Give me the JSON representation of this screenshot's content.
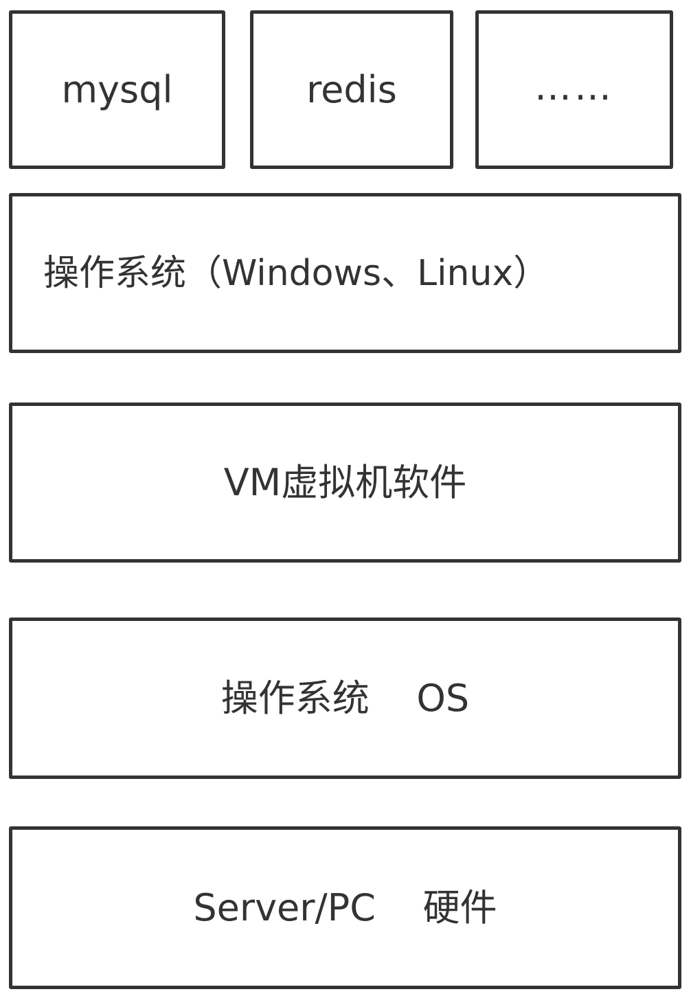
{
  "stack": {
    "apps": [
      {
        "label": "mysql"
      },
      {
        "label": "redis"
      },
      {
        "label": "……"
      }
    ],
    "guest_os": {
      "label": "操作系统（Windows、Linux）"
    },
    "vm_software": {
      "label": "VM虚拟机软件"
    },
    "host_os": {
      "label": "操作系统    OS"
    },
    "hardware": {
      "label": "Server/PC    硬件"
    }
  },
  "colors": {
    "stroke": "#333333",
    "text": "#333333",
    "background": "#ffffff"
  }
}
